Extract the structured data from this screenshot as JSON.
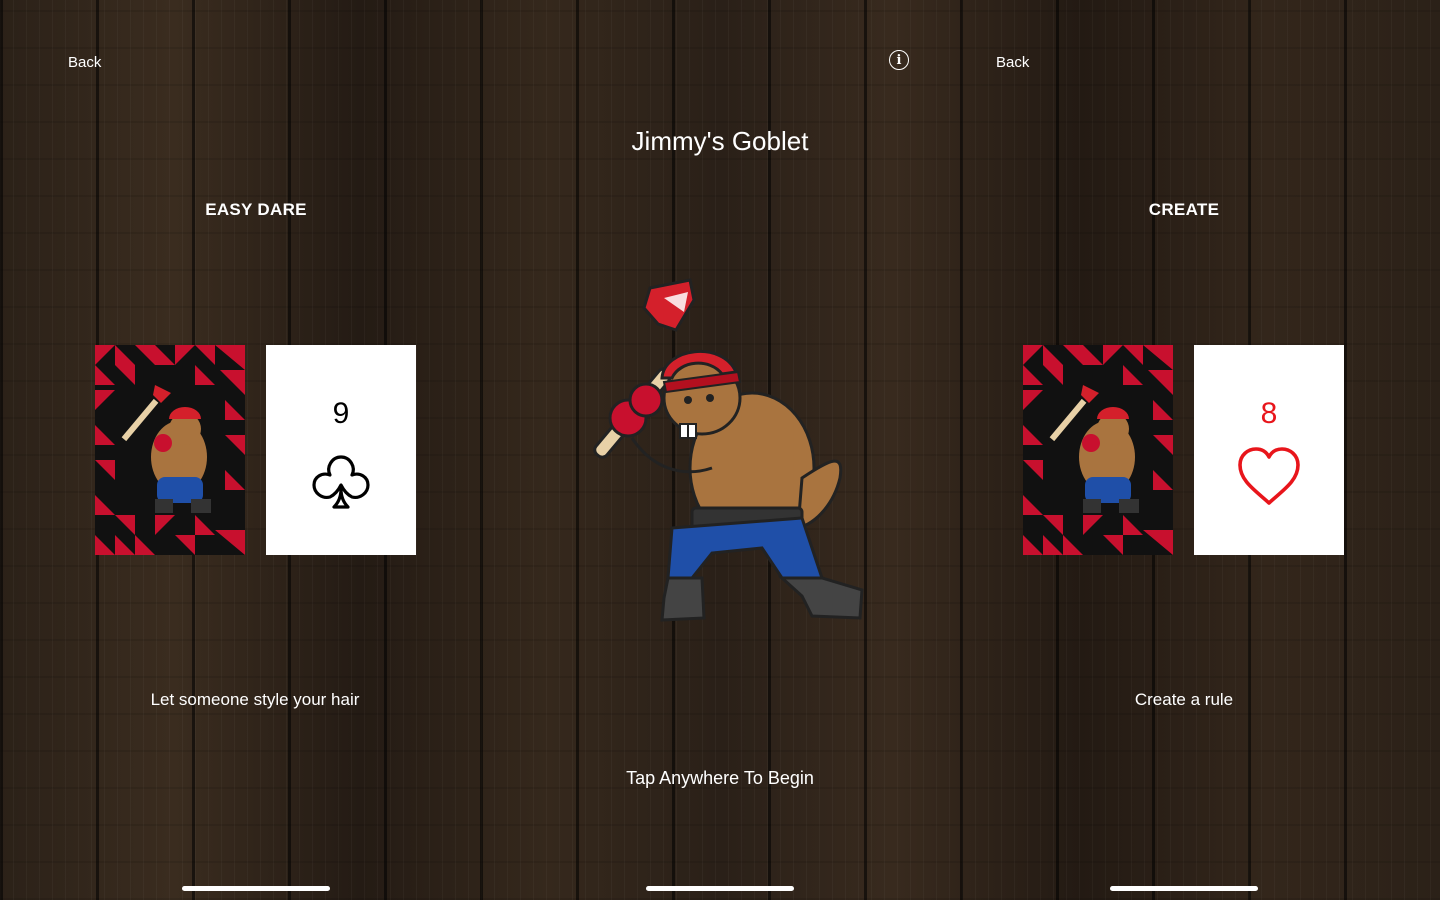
{
  "left_panel": {
    "back_label": "Back",
    "category": "EASY DARE",
    "card": {
      "rank": "9",
      "suit": "clubs",
      "suit_icon": "club-icon",
      "color": "#000000"
    },
    "prompt": "Let someone style your hair"
  },
  "center_panel": {
    "title": "Jimmy's Goblet",
    "mascot_icon": "beaver-lumberjack-icon",
    "instruction": "Tap Anywhere To Begin",
    "info_icon": "info-icon"
  },
  "right_panel": {
    "back_label": "Back",
    "category": "CREATE",
    "card": {
      "rank": "8",
      "suit": "hearts",
      "suit_icon": "heart-icon",
      "color": "#e8151b"
    },
    "prompt": "Create a rule"
  },
  "theme": {
    "card_back_red": "#c8102e",
    "card_back_black": "#111111",
    "text": "#ffffff"
  }
}
